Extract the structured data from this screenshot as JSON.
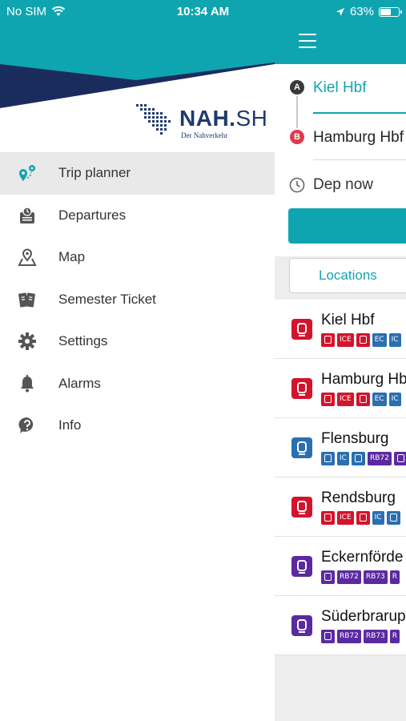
{
  "status_bar": {
    "carrier": "No SIM",
    "time": "10:34 AM",
    "battery_percent": "63%",
    "battery_level": 0.63
  },
  "brand": {
    "logo_text_bold": "NAH.",
    "logo_text_light": "SH",
    "tagline": "Der Nahverkehr",
    "colors": {
      "teal": "#0fa5b0",
      "navy": "#1a2c5c",
      "logo": "#1f3a6b",
      "ice_red": "#d3142c",
      "ic_blue": "#2a6fb0",
      "rb_purple": "#5b2aa0"
    }
  },
  "drawer": {
    "items": [
      {
        "label": "Trip planner",
        "icon": "route-pin-icon",
        "active": true
      },
      {
        "label": "Departures",
        "icon": "departures-board-icon",
        "active": false
      },
      {
        "label": "Map",
        "icon": "map-pin-icon",
        "active": false
      },
      {
        "label": "Semester Ticket",
        "icon": "tickets-icon",
        "active": false
      },
      {
        "label": "Settings",
        "icon": "gear-icon",
        "active": false
      },
      {
        "label": "Alarms",
        "icon": "bell-icon",
        "active": false
      },
      {
        "label": "Info",
        "icon": "question-icon",
        "active": false
      }
    ]
  },
  "trip_form": {
    "origin_badge": "A",
    "origin": "Kiel Hbf",
    "destination_badge": "B",
    "destination": "Hamburg Hbf",
    "time": "Dep now",
    "tab_label": "Locations"
  },
  "locations": [
    {
      "name": "Kiel Hbf",
      "type": "ice",
      "chips": [
        "ICE",
        "",
        "EC",
        "IC"
      ]
    },
    {
      "name": "Hamburg Hbf",
      "type": "ice",
      "chips": [
        "ICE",
        "",
        "EC",
        "IC"
      ]
    },
    {
      "name": "Flensburg",
      "type": "ic",
      "chips": [
        "IC",
        "",
        "RB72",
        ""
      ]
    },
    {
      "name": "Rendsburg",
      "type": "ice",
      "chips": [
        "ICE",
        "",
        "IC",
        ""
      ]
    },
    {
      "name": "Eckernförde",
      "type": "rb",
      "chips": [
        "RB72",
        "RB73",
        "R"
      ]
    },
    {
      "name": "Süderbrarup",
      "type": "rb",
      "chips": [
        "RB72",
        "RB73",
        "R"
      ]
    }
  ]
}
